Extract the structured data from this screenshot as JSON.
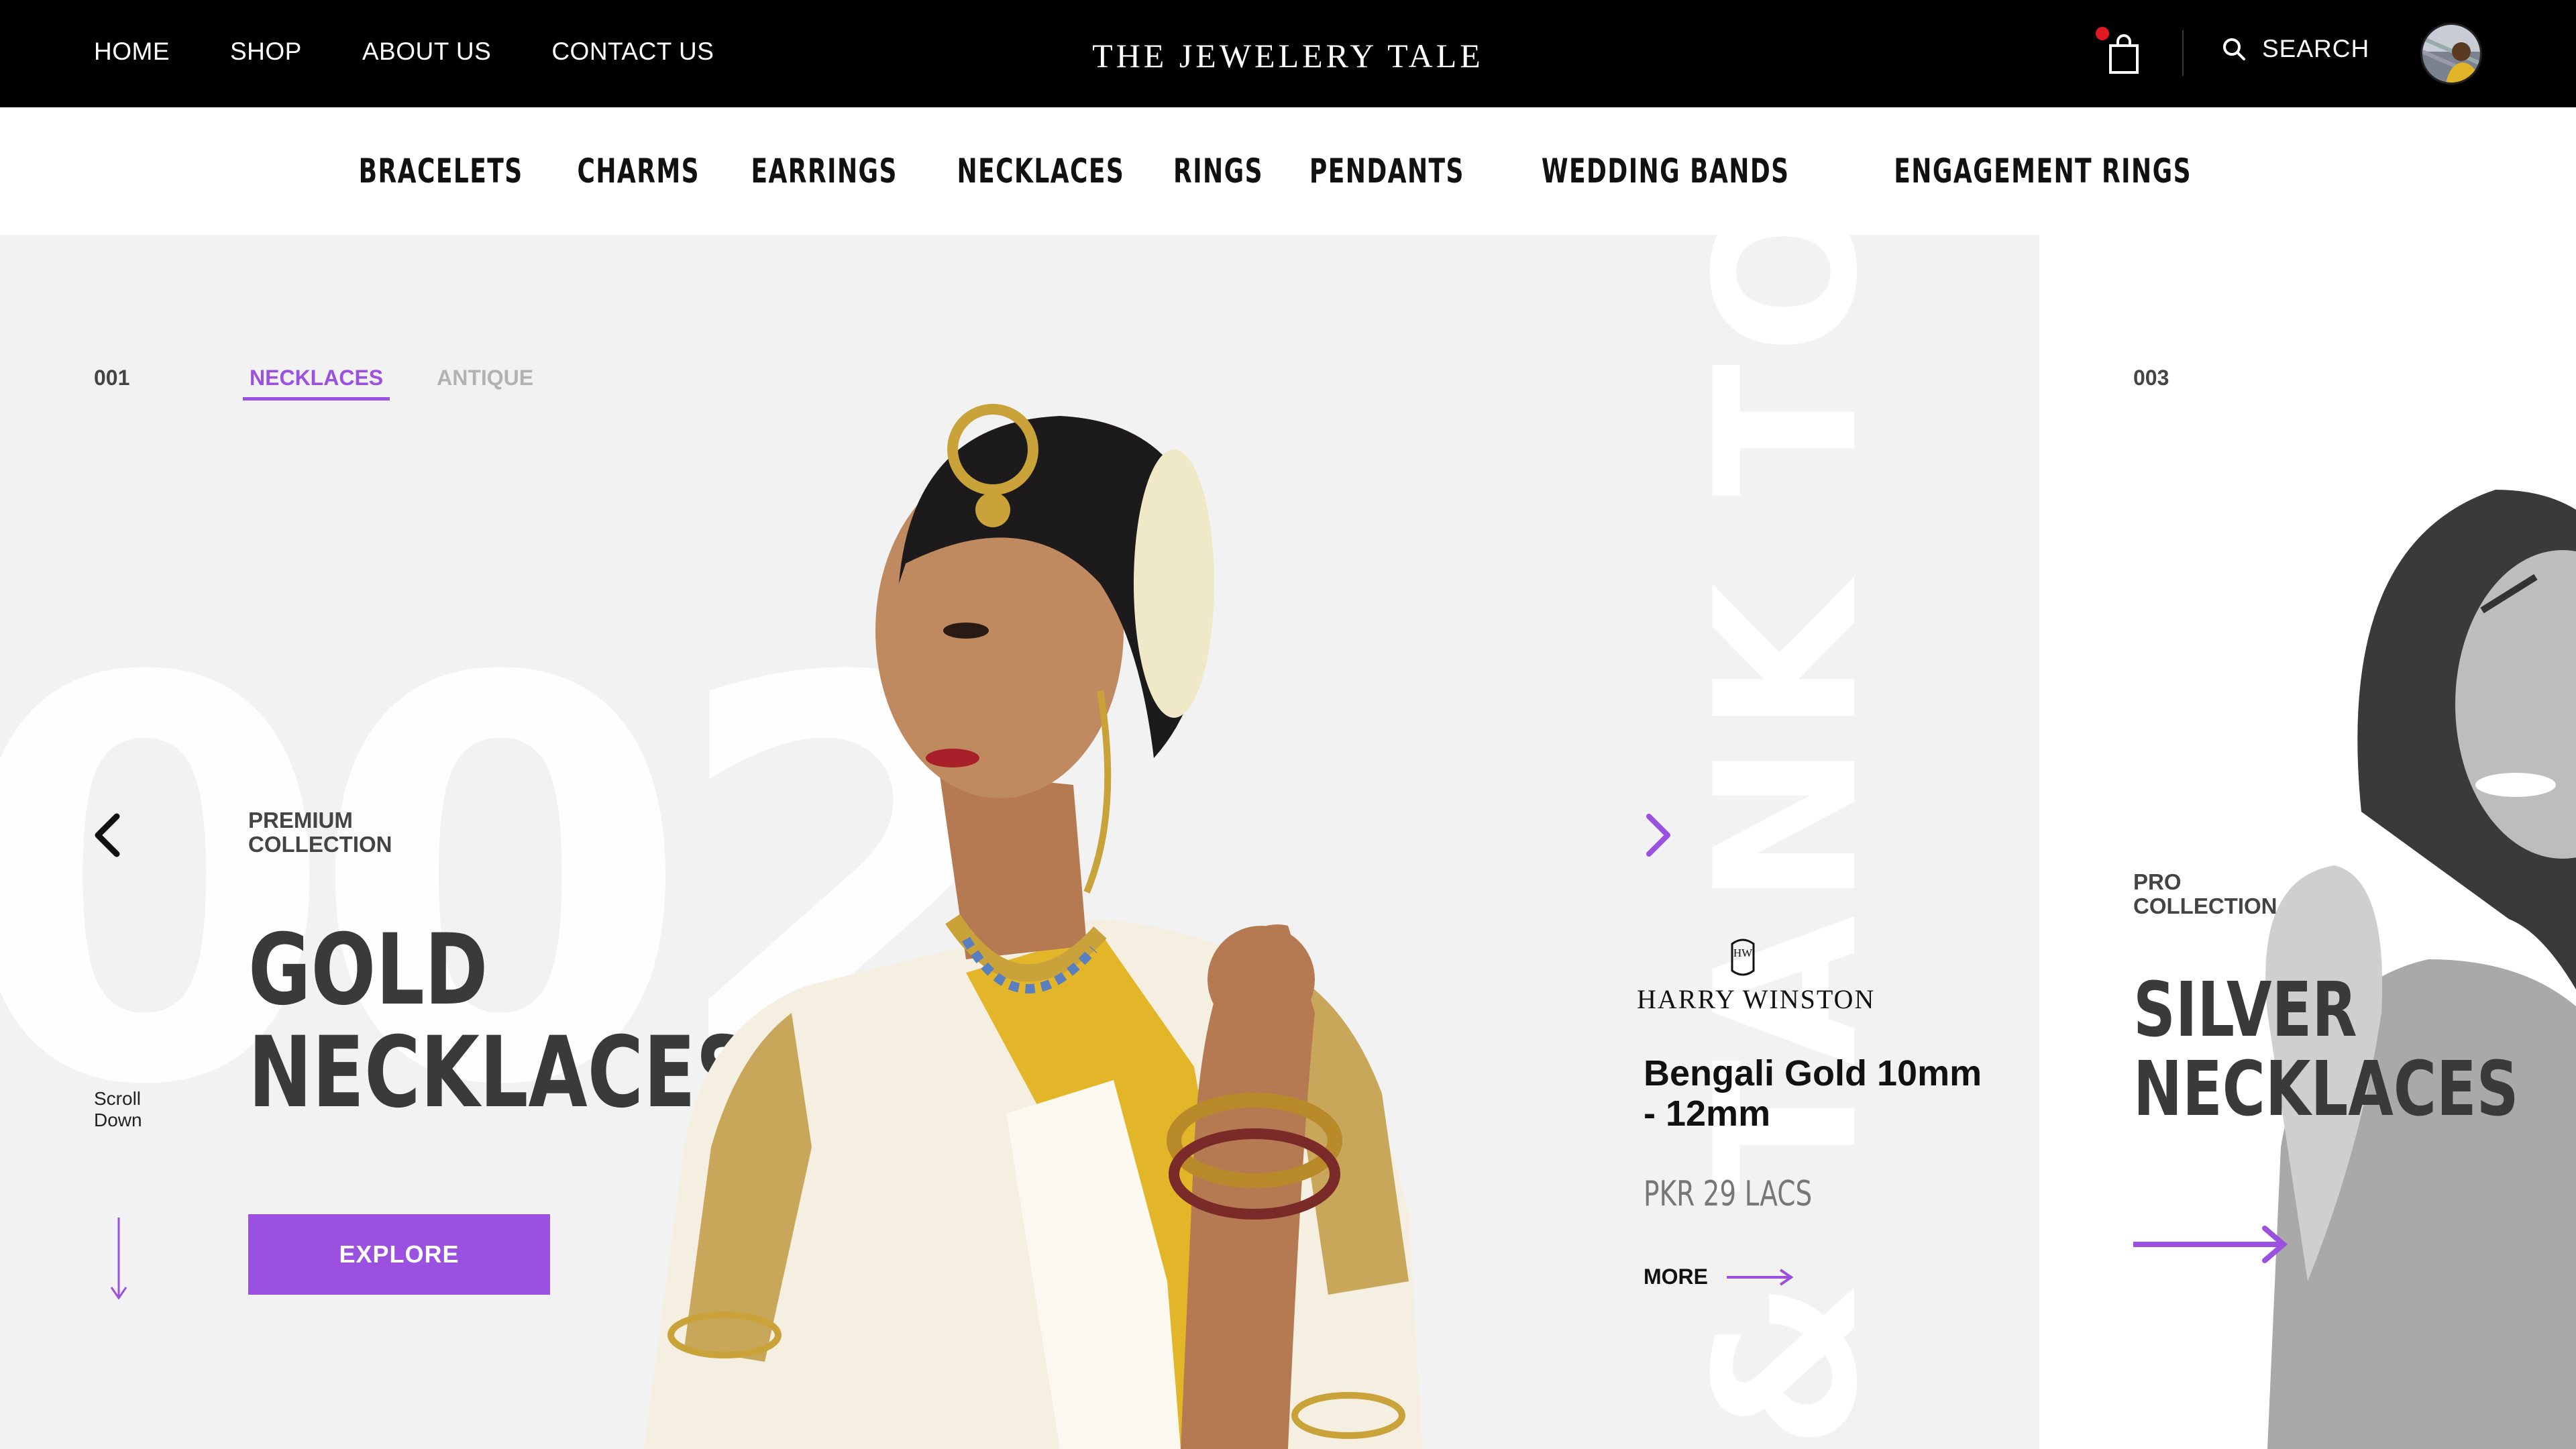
{
  "header": {
    "nav": [
      "HOME",
      "SHOP",
      "ABOUT US",
      "CONTACT US"
    ],
    "brand": "THE JEWELERY TALE",
    "search_label": "SEARCH"
  },
  "categories": [
    "BRACELETS",
    "CHARMS",
    "EARRINGS",
    "NECKLACES",
    "RINGS",
    "PENDANTS",
    "WEDDING BANDS",
    "ENGAGEMENT RINGS"
  ],
  "hero": {
    "slide_number": "001",
    "background_number": "002",
    "vertical_text": "& TANK TOP",
    "tabs": [
      "NECKLACES",
      "ANTIQUE"
    ],
    "active_tab": "NECKLACES",
    "collection_label": "PREMIUM COLLECTION",
    "title_line1": "GOLD",
    "title_line2": "NECKLACES",
    "explore_label": "EXPLORE",
    "scroll_hint": "Scroll Down"
  },
  "product": {
    "brand_monogram": "HW",
    "brand": "HARRY WINSTON",
    "name": "Bengali Gold 10mm - 12mm",
    "price": "PKR 29 LACS",
    "more_label": "MORE"
  },
  "next_slide": {
    "number": "003",
    "collection_label": "PRO COLLECTION",
    "title_line1": "SILVER",
    "title_line2": "NECKLACES"
  },
  "colors": {
    "accent": "#9b51e0",
    "header_bg": "#000000",
    "hero_bg": "#f2f2f2",
    "cart_badge": "#e01822"
  },
  "icons": [
    "shopping-bag-icon",
    "search-icon",
    "chevron-left-icon",
    "chevron-right-icon",
    "arrow-down-icon",
    "arrow-right-icon"
  ]
}
